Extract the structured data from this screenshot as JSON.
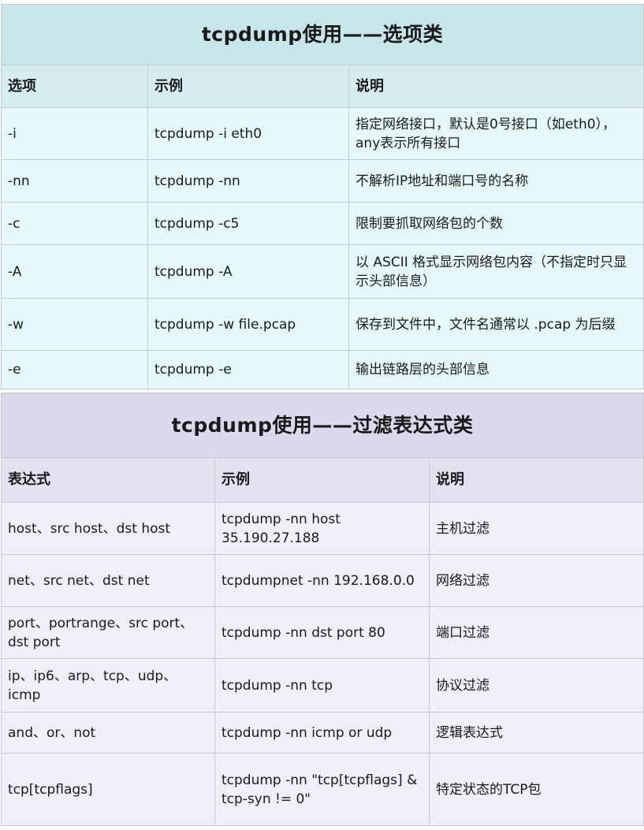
{
  "options_table": {
    "title": "tcpdump使用——选项类",
    "headers": [
      "选项",
      "示例",
      "说明"
    ],
    "rows": [
      [
        "-i",
        "tcpdump -i eth0",
        "指定网络接口，默认是0号接口（如eth0），any表示所有接口"
      ],
      [
        "-nn",
        "tcpdump -nn",
        "不解析IP地址和端口号的名称"
      ],
      [
        "-c",
        "tcpdump -c5",
        "限制要抓取网络包的个数"
      ],
      [
        "-A",
        "tcpdump -A",
        "以 ASCII 格式显示网络包内容（不指定时只显示头部信息）"
      ],
      [
        "-w",
        "tcpdump -w file.pcap",
        "保存到文件中，文件名通常以 .pcap 为后缀"
      ],
      [
        "-e",
        "tcpdump -e",
        "输出链路层的头部信息"
      ]
    ]
  },
  "filter_table": {
    "title": "tcpdump使用——过滤表达式类",
    "headers": [
      "表达式",
      "示例",
      "说明"
    ],
    "rows": [
      [
        "host、src host、dst host",
        "tcpdump -nn host 35.190.27.188",
        "主机过滤"
      ],
      [
        "net、src net、dst net",
        "tcpdumpnet -nn 192.168.0.0",
        "网络过滤"
      ],
      [
        "port、portrange、src port、dst port",
        "tcpdump -nn dst port 80",
        "端口过滤"
      ],
      [
        "ip、ip6、arp、tcp、udp、icmp",
        "tcpdump -nn tcp",
        "协议过滤"
      ],
      [
        "and、or、not",
        "tcpdump -nn icmp or udp",
        "逻辑表达式"
      ],
      [
        "tcp[tcpflags]",
        "tcpdump -nn \"tcp[tcpflags] & tcp-syn != 0\"",
        "特定状态的TCP包"
      ]
    ]
  }
}
